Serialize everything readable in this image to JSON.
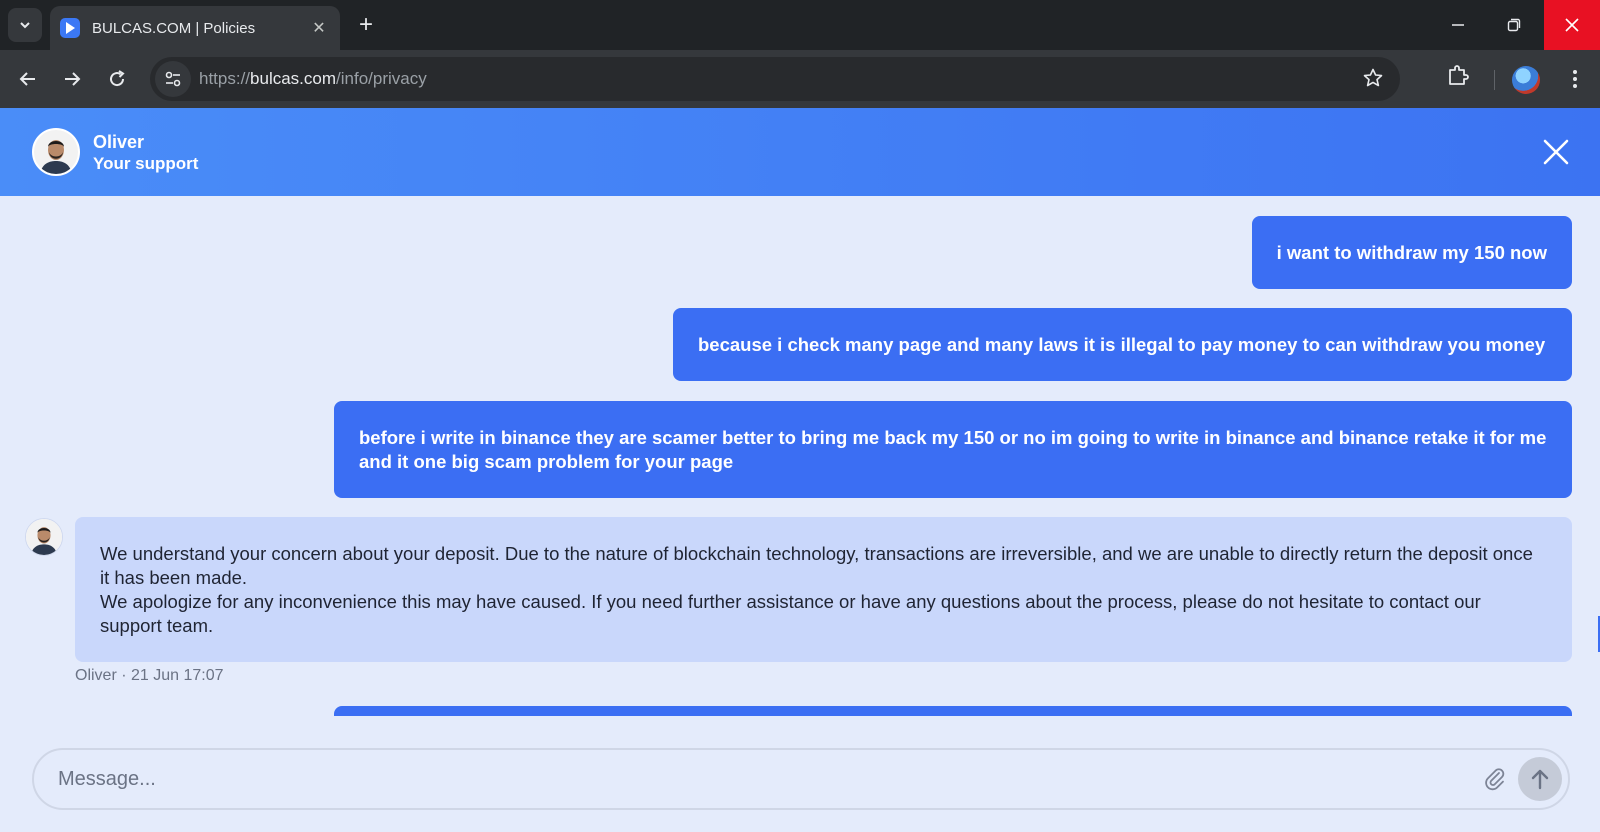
{
  "browser": {
    "tab_title": "BULCAS.COM | Policies",
    "url_scheme": "https://",
    "url_host": "bulcas.com",
    "url_path": "/info/privacy"
  },
  "chat": {
    "agent_name": "Oliver",
    "agent_role": "Your support",
    "accent_color": "#3b6ef3",
    "messages": [
      {
        "from": "user",
        "text": "i want to withdraw my 150 now"
      },
      {
        "from": "user",
        "text": "because i check many page and many laws it is illegal to pay money to can withdraw you money"
      },
      {
        "from": "user",
        "text": "before i write in binance they are scamer better to bring me back my 150 or no im going to write in binance and binance retake it for me and it one big scam problem for your page"
      },
      {
        "from": "agent",
        "line1": "We understand your concern about your deposit. Due to the nature of blockchain technology, transactions are irreversible, and we are unable to directly return the deposit once it has been made.",
        "line2": "We apologize for any inconvenience this may have caused. If you need further assistance or have any questions about the process, please do not hesitate to contact our support team.",
        "meta": "Oliver · 21 Jun 17:07"
      }
    ],
    "composer_placeholder": "Message..."
  }
}
